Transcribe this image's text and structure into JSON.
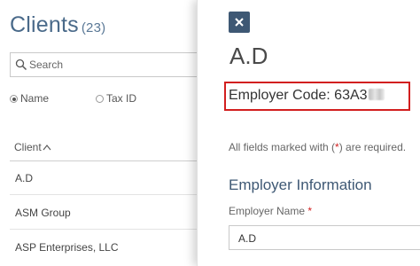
{
  "clients": {
    "title": "Clients",
    "count": "(23)",
    "search_placeholder": "Search",
    "radio_name": "Name",
    "radio_tax": "Tax ID",
    "column_header": "Client",
    "sort_indicator": "^",
    "rows": [
      "A.D",
      "ASM Group",
      "ASP Enterprises, LLC"
    ]
  },
  "detail": {
    "close_label": "×",
    "name": "A.D",
    "employer_code_label": "Employer Code: 63A3",
    "required_prefix": "All fields marked with (",
    "required_asterisk": "*",
    "required_suffix": ") are required.",
    "section_title": "Employer Information",
    "employer_name_label": "Employer Name",
    "employer_name_asterisk": "*",
    "employer_name_value": "A.D"
  },
  "colors": {
    "accent": "#3e5874",
    "highlight_border": "#d21f1f"
  }
}
